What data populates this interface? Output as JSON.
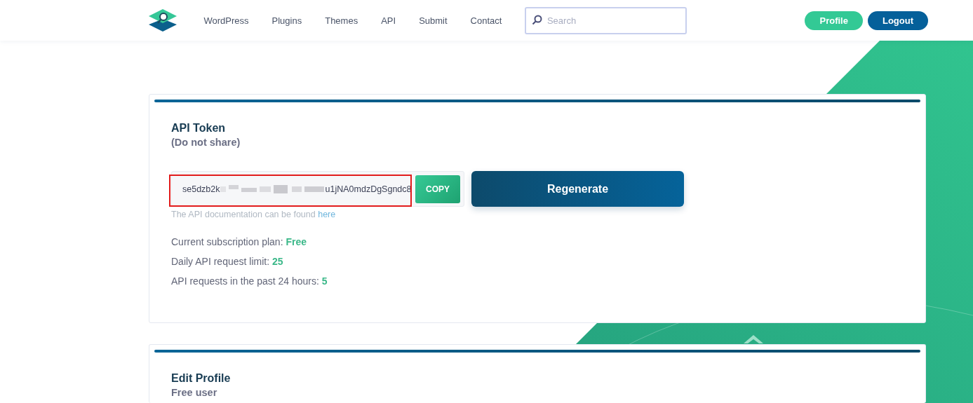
{
  "header": {
    "nav": [
      {
        "label": "WordPress"
      },
      {
        "label": "Plugins"
      },
      {
        "label": "Themes"
      },
      {
        "label": "API"
      },
      {
        "label": "Submit"
      },
      {
        "label": "Contact"
      }
    ],
    "search": {
      "placeholder": "Search"
    },
    "buttons": [
      {
        "label": "Profile",
        "kind": "primary"
      },
      {
        "label": "Logout",
        "kind": "secondary"
      }
    ]
  },
  "api_token_card": {
    "title": "API Token",
    "subtitle": "(Do not share)",
    "token": {
      "visible_start": "se5dzb2k",
      "visible_end": "u1jNA0mdzDgSgndc8",
      "highlighted": true
    },
    "copy_button": "COPY",
    "regenerate_button": "Regenerate",
    "doc_note": {
      "text": "The API documentation can be found",
      "link": "here"
    },
    "stats": [
      {
        "label": "Current subscription plan:",
        "value": "Free"
      },
      {
        "label": "Daily API request limit:",
        "value": "25"
      },
      {
        "label": "API requests in the past 24 hours:",
        "value": "5"
      }
    ]
  },
  "profile_card": {
    "title": "Edit Profile",
    "subtitle": "Free user"
  }
}
